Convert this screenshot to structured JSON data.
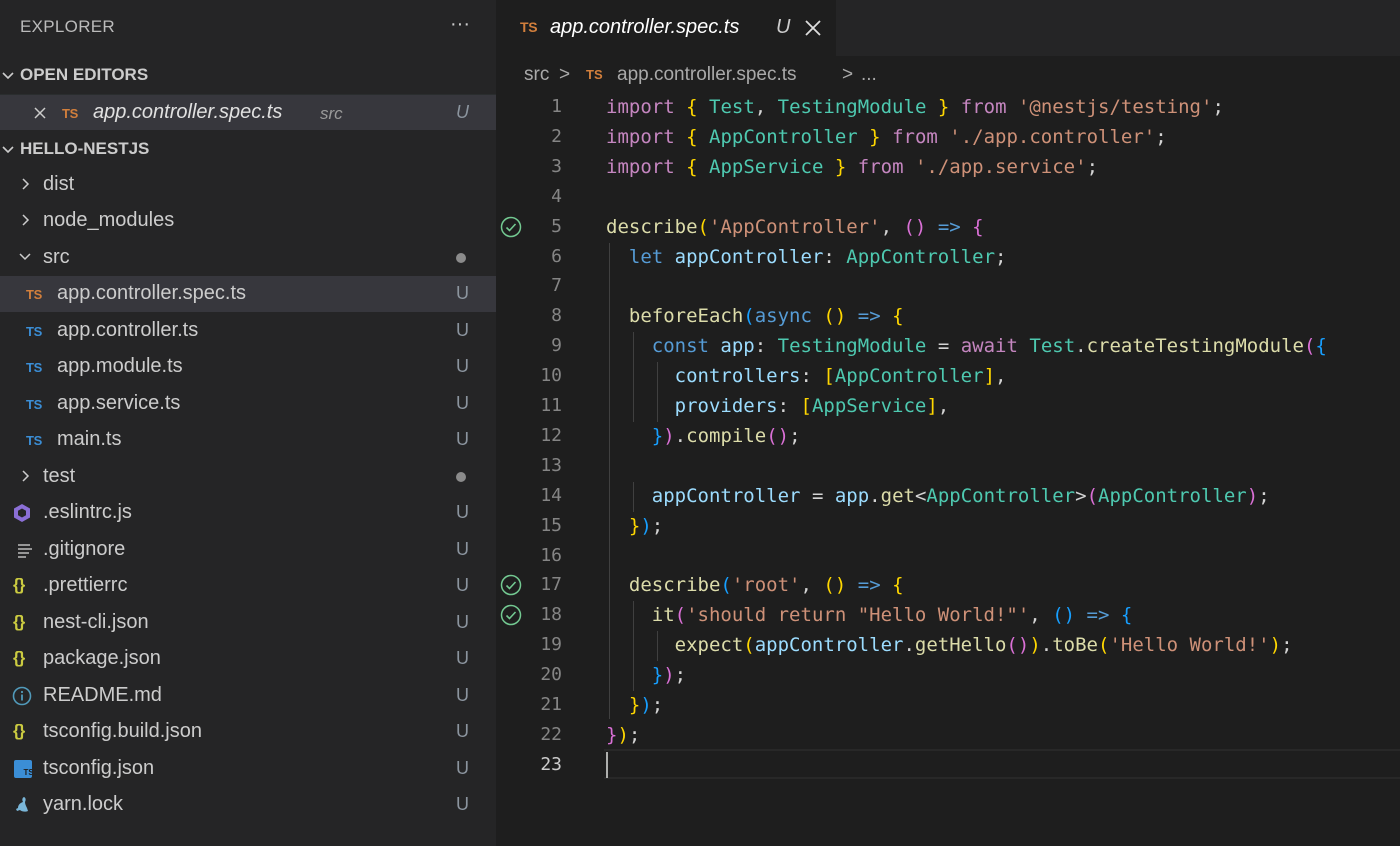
{
  "sidebar": {
    "title": "EXPLORER",
    "more_label": "···",
    "open_editors": {
      "header": "OPEN EDITORS",
      "items": [
        {
          "name": "app.controller.spec.ts",
          "folder": "src",
          "status": "U",
          "badge": "TS"
        }
      ]
    },
    "project": {
      "header": "HELLO-NESTJS",
      "items": [
        {
          "name": "dist",
          "type": "folder"
        },
        {
          "name": "node_modules",
          "type": "folder"
        },
        {
          "name": "src",
          "type": "folder-open"
        },
        {
          "name": "app.controller.spec.ts",
          "badge": "TS",
          "status": "U"
        },
        {
          "name": "app.controller.ts",
          "badge": "TS",
          "status": "U"
        },
        {
          "name": "app.module.ts",
          "badge": "TS",
          "status": "U"
        },
        {
          "name": "app.service.ts",
          "badge": "TS",
          "status": "U"
        },
        {
          "name": "main.ts",
          "badge": "TS",
          "status": "U"
        },
        {
          "name": "test",
          "type": "folder"
        },
        {
          "name": ".eslintrc.js",
          "icon": "eslint-icon",
          "status": "U"
        },
        {
          "name": ".gitignore",
          "icon": "lines-icon",
          "status": "U"
        },
        {
          "name": ".prettierrc",
          "icon": "json-icon",
          "status": "U"
        },
        {
          "name": "nest-cli.json",
          "icon": "json-icon",
          "status": "U"
        },
        {
          "name": "package.json",
          "icon": "json-icon",
          "status": "U"
        },
        {
          "name": "README.md",
          "icon": "info-icon",
          "status": "U"
        },
        {
          "name": "tsconfig.build.json",
          "icon": "json-icon",
          "status": "U"
        },
        {
          "name": "tsconfig.json",
          "icon": "ts-file-icon",
          "status": "U"
        },
        {
          "name": "yarn.lock",
          "icon": "yarn-icon",
          "status": "U"
        }
      ]
    }
  },
  "editor": {
    "tab": {
      "badge": "TS",
      "label": "app.controller.spec.ts",
      "status": "U"
    },
    "breadcrumb": [
      "src",
      ">",
      "TS",
      "app.controller.spec.ts",
      ">",
      "..."
    ],
    "line_numbers": [
      "1",
      "2",
      "3",
      "4",
      "5",
      "6",
      "7",
      "8",
      "9",
      "10",
      "11",
      "12",
      "13",
      "14",
      "15",
      "16",
      "17",
      "18",
      "19",
      "20",
      "21",
      "22",
      "23"
    ],
    "code_lines": [
      "import { Test, TestingModule } from '@nestjs/testing';",
      "import { AppController } from './app.controller';",
      "import { AppService } from './app.service';",
      "",
      "describe('AppController', () => {",
      "  let appController: AppController;",
      "",
      "  beforeEach(async () => {",
      "    const app: TestingModule = await Test.createTestingModule({",
      "      controllers: [AppController],",
      "      providers: [AppService],",
      "    }).compile();",
      "",
      "    appController = app.get<AppController>(AppController);",
      "  });",
      "",
      "  describe('root', () => {",
      "    it('should return \"Hello World!\"', () => {",
      "      expect(appController.getHello()).toBe('Hello World!');",
      "    });",
      "  });",
      "});",
      ""
    ]
  },
  "colors": {
    "keyword": "#c586c0",
    "storage": "#569cd6",
    "type": "#4ec9b0",
    "variable": "#9cdcfe",
    "function": "#dcdcaa",
    "string": "#ce9178",
    "ts_badge_orange": "#d27f3c",
    "ts_badge_blue": "#3b8ed6",
    "test_pass": "#73c991"
  }
}
